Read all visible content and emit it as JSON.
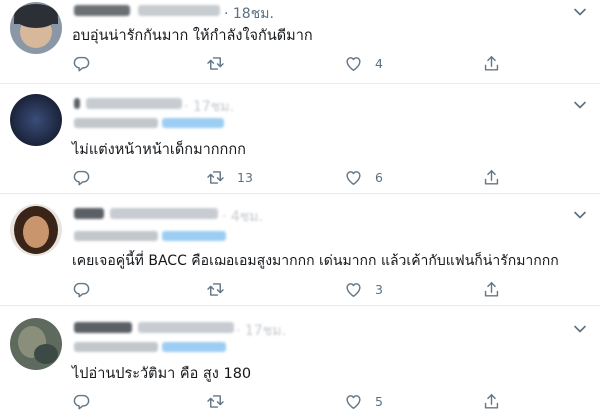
{
  "tweets": [
    {
      "name": "Miclane",
      "time": "· 18ชม.",
      "text": "อบอุ่นน่ารักกันมาก ให้กำลังใจกันดีมาก",
      "counts": {
        "reply": "",
        "retweet": "",
        "like": "4"
      }
    },
    {
      "name": "",
      "time": "· 17ชม.",
      "text": "ไม่แต่งหน้าหน้าเด็กมากกกก",
      "counts": {
        "reply": "",
        "retweet": "13",
        "like": "6"
      }
    },
    {
      "name": "",
      "time": "· 4ชม.",
      "text": "เคยเจอคู่นี้ที่ BACC คือเฌอเอมสูงมากกก เด่นมากก แล้วเค้ากับแฟนก็น่ารักมากกก",
      "counts": {
        "reply": "",
        "retweet": "",
        "like": "3"
      }
    },
    {
      "name": "",
      "time": "· 17ชม.",
      "text": "ไปอ่านประวัติมา คือ สูง 180",
      "counts": {
        "reply": "",
        "retweet": "",
        "like": "5"
      }
    }
  ],
  "icons": {
    "reply": "reply-icon",
    "retweet": "retweet-icon",
    "like": "heart-icon",
    "share": "share-icon",
    "menu": "chevron-down-icon"
  },
  "colors": {
    "text": "#14171a",
    "secondary": "#5b7083",
    "mention": "#1da1f2",
    "divider": "#e6ecf0"
  }
}
